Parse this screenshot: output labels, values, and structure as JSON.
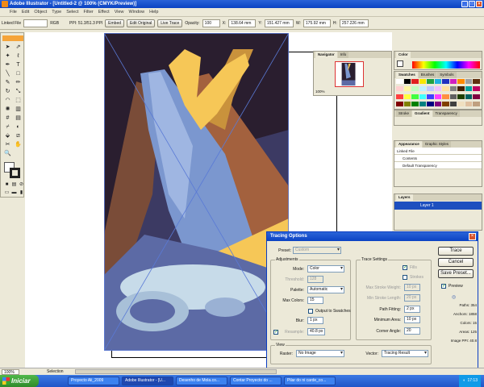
{
  "window": {
    "title": "Adobe Illustrator - [Untitled-2 @ 100% (CMYK/Preview)]"
  },
  "menu": [
    "File",
    "Edit",
    "Object",
    "Type",
    "Select",
    "Filter",
    "Effect",
    "View",
    "Window",
    "Help"
  ],
  "control": {
    "linked_file": "Linked File",
    "color_mode": "RGB",
    "ppi": "PPI: 51.3/51.3 PPI",
    "embed": "Embed",
    "edit_original": "Edit Original",
    "live_trace": "Live Trace",
    "opacity_label": "Opacity:",
    "opacity": "100",
    "x_label": "X:",
    "x": "138.64 mm",
    "y_label": "Y:",
    "y": "151.427 mm",
    "w_label": "W:",
    "w": "175.92 mm",
    "h_label": "H:",
    "h": "257.226 mm"
  },
  "navigator": {
    "tabs": [
      "Navigator",
      "Info"
    ],
    "zoom": "100%"
  },
  "color_panel": {
    "tabs": [
      "Color"
    ]
  },
  "swatches_panel": {
    "tabs": [
      "Swatches",
      "Brushes",
      "Symbols"
    ]
  },
  "stroke_panel": {
    "tabs": [
      "Stroke",
      "Gradient",
      "Transparency"
    ]
  },
  "appearance": {
    "tabs": [
      "Appearance",
      "Graphic Styles"
    ],
    "rows": [
      "Linked File",
      "Contents",
      "Default Transparency"
    ]
  },
  "layers": {
    "tabs": [
      "Layers"
    ],
    "layer_name": "Layer 1"
  },
  "colors": {
    "bg_dark": "#2a1e2f",
    "blue_beam": "#7b97cf",
    "orange_beam": "#a3613e",
    "yellow": "#f6c757",
    "floor": "#5c6aa5",
    "light": "#c7dbe9",
    "accent": "#0b43c3"
  },
  "swatch_colors": [
    "#ffffff",
    "#000000",
    "#e02020",
    "#f7e600",
    "#20a040",
    "#20b0e0",
    "#2030c0",
    "#d020c0",
    "#ff8a00",
    "#a0a0a0",
    "#603010",
    "#ffd0d0",
    "#fff5a0",
    "#c0ffc0",
    "#c0f0ff",
    "#c0c8ff",
    "#f0c0ff",
    "#ffe0a0",
    "#808080",
    "#402000",
    "#00a0a0",
    "#c00060",
    "#ff4040",
    "#ffff40",
    "#40ff40",
    "#40ffff",
    "#4040ff",
    "#ff40ff",
    "#ff9040",
    "#606060",
    "#204000",
    "#006060",
    "#800040",
    "#800000",
    "#808000",
    "#008000",
    "#008080",
    "#000080",
    "#800080",
    "#804000",
    "#404040",
    "#f0e0c0",
    "#e0c0a0",
    "#c0a080"
  ],
  "tracing": {
    "title": "Tracing Options",
    "preset_label": "Preset:",
    "preset": "Custom",
    "adjustments_label": "Adjustments",
    "mode_label": "Mode:",
    "mode": "Color",
    "threshold_label": "Threshold:",
    "threshold": "128",
    "palette_label": "Palette:",
    "palette": "Automatic",
    "max_colors_label": "Max Colors:",
    "max_colors": "15",
    "output_swatches": "Output to Swatches",
    "blur_label": "Blur:",
    "blur": "1 px",
    "resample_label": "Resample:",
    "resample": "40.8 px",
    "trace_settings_label": "Trace Settings",
    "fills": "Fills",
    "strokes": "Strokes",
    "max_stroke_weight_label": "Max Stroke Weight:",
    "max_stroke_weight": "10 px",
    "min_stroke_length_label": "Min Stroke Length:",
    "min_stroke_length": "20 px",
    "path_fitting_label": "Path Fitting:",
    "path_fitting": "2 px",
    "minimum_area_label": "Minimum Area:",
    "minimum_area": "10 px",
    "corner_angle_label": "Corner Angle:",
    "corner_angle": "20",
    "view_label": "View",
    "raster_label": "Raster:",
    "raster": "No Image",
    "vector_label": "Vector:",
    "vector": "Tracing Result",
    "buttons": {
      "trace": "Trace",
      "cancel": "Cancel",
      "save_preset": "Save Preset..."
    },
    "preview": "Preview",
    "stats": [
      "Paths: 354",
      "Anchors: 1858",
      "Colors: 15",
      "Areas: 125",
      "Image PPI: 40.8"
    ]
  },
  "status": {
    "zoom": "100%",
    "tool": "Selection"
  },
  "taskbar": {
    "start": "Iniciar",
    "tasks": [
      "Proyecto Ali_2009",
      "Adobe Illustrator - [U...",
      "Desenho de Mola.co...",
      "Contar Proyecto do ...",
      "Pilar do ni carde_co..."
    ],
    "time": "17:13"
  }
}
